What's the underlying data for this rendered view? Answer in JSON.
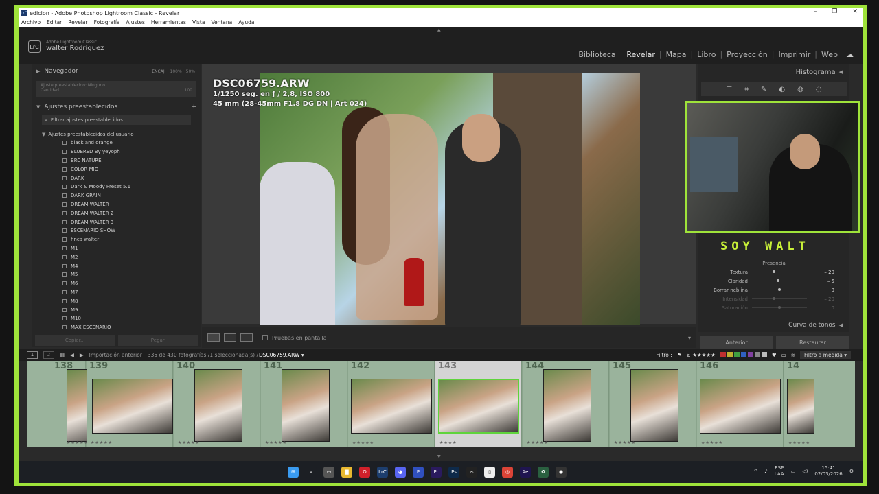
{
  "window": {
    "title": "edicion - Adobe Photoshop Lightroom Classic - Revelar",
    "app_badge": "LrC",
    "controls": [
      "–",
      "❐",
      "✕"
    ]
  },
  "menu": [
    "Archivo",
    "Editar",
    "Revelar",
    "Fotografía",
    "Ajustes",
    "Herramientas",
    "Vista",
    "Ventana",
    "Ayuda"
  ],
  "identity": {
    "logo": "LrC",
    "product": "Adobe Lightroom Classic",
    "user": "walter Rodriguez"
  },
  "modules": [
    "Biblioteca",
    "Revelar",
    "Mapa",
    "Libro",
    "Proyección",
    "Imprimir",
    "Web"
  ],
  "active_module": "Revelar",
  "left_panel": {
    "navigator": "Navegador",
    "nav_fit": "ENCAJ.",
    "nav_100": "100%",
    "nav_50": "50%",
    "preview_label": "Ajuste preestablecido: Ninguno",
    "amount_label": "Cantidad",
    "amount_value": "100",
    "presets_title": "Ajustes preestablecidos",
    "presets_add": "+",
    "filter_placeholder": "Filtrar ajustes preestablecidos",
    "user_group": "Ajustes preestablecidos del usuario",
    "presets": [
      "black and orange",
      "BLUERED By yeyoph",
      "BRC NATURE",
      "COLOR MIO",
      "DARK",
      "Dark & Moody Preset 5.1",
      "DARK GRAIN",
      "DREAM WALTER",
      "DREAM WALTER 2",
      "DREAM WALTER 3",
      "ESCENARIO SHOW",
      "finca walter",
      "M1",
      "M2",
      "M4",
      "M5",
      "M6",
      "M7",
      "M8",
      "M9",
      "M10",
      "MAX ESCENARIO"
    ],
    "copy_button": "Copiar...",
    "paste_button": "Pegar"
  },
  "photo": {
    "filename": "DSC06759.ARW",
    "exposure": "1/1250 seg. en ƒ / 2,8, ISO 800",
    "lens": "45 mm (28-45mm F1.8 DG DN | Art 024)"
  },
  "center_toolbar": {
    "softproof": "Pruebas en pantalla"
  },
  "right_panel": {
    "histogram": "Histograma",
    "presence": "Presencia",
    "sliders": [
      {
        "label": "Textura",
        "value": "– 20",
        "pos": 0.4
      },
      {
        "label": "Claridad",
        "value": "– 5",
        "pos": 0.47
      },
      {
        "label": "Borrar neblina",
        "value": "0",
        "pos": 0.5
      },
      {
        "label": "Intensidad",
        "value": "– 20",
        "pos": 0.4
      },
      {
        "label": "Saturación",
        "value": "0",
        "pos": 0.5
      }
    ],
    "tone_curve": "Curva de tonos",
    "prev_button": "Anterior",
    "reset_button": "Restaurar"
  },
  "overlay": {
    "caption": "SOY WALT"
  },
  "filmstrip_bar": {
    "screen1": "1",
    "screen2": "2",
    "source": "Importación anterior",
    "count": "335 de 430 fotografías /1 seleccionada(s) /",
    "current": "DSC06759.ARW ▾",
    "filter_label": "Filtro :",
    "rating": "≥ ★★★★★",
    "colors": [
      "#c03030",
      "#c0b030",
      "#40a040",
      "#3060c0",
      "#8040a0",
      "#888888",
      "#bbbbbb"
    ],
    "custom_filter": "Filtro a medida ▾"
  },
  "filmstrip": [
    {
      "num": "138",
      "stars": "★★★★★"
    },
    {
      "num": "139",
      "stars": "★★★★★"
    },
    {
      "num": "140",
      "stars": "★★★★★"
    },
    {
      "num": "141",
      "stars": "★★★★★"
    },
    {
      "num": "142",
      "stars": "★★★★★"
    },
    {
      "num": "143",
      "stars": "★★★★",
      "selected": true
    },
    {
      "num": "144",
      "stars": "★★★★★"
    },
    {
      "num": "145",
      "stars": "★★★★★"
    },
    {
      "num": "146",
      "stars": "★★★★★"
    },
    {
      "num": "14",
      "stars": "★★★★★"
    }
  ],
  "taskbar": {
    "apps": [
      {
        "name": "windows-start-icon",
        "glyph": "⊞",
        "color": "#3a9bf0"
      },
      {
        "name": "search-icon",
        "glyph": "⌕",
        "color": "#1c1f24"
      },
      {
        "name": "task-view-icon",
        "glyph": "▭",
        "color": "#555"
      },
      {
        "name": "file-explorer-icon",
        "glyph": "▇",
        "color": "#e8b830"
      },
      {
        "name": "opera-icon",
        "glyph": "O",
        "color": "#d0202a"
      },
      {
        "name": "lightroom-icon",
        "glyph": "LrC",
        "color": "#1d3e6e"
      },
      {
        "name": "discord-icon",
        "glyph": "◕",
        "color": "#5865f2"
      },
      {
        "name": "notes-icon",
        "glyph": "P",
        "color": "#3050c0"
      },
      {
        "name": "premiere-icon",
        "glyph": "Pr",
        "color": "#2a1a5e"
      },
      {
        "name": "photoshop-icon",
        "glyph": "Ps",
        "color": "#0e2a4a"
      },
      {
        "name": "capcut-icon",
        "glyph": "✂",
        "color": "#222"
      },
      {
        "name": "document-icon",
        "glyph": "▯",
        "color": "#eee"
      },
      {
        "name": "chrome-icon",
        "glyph": "◎",
        "color": "#db4437"
      },
      {
        "name": "after-effects-icon",
        "glyph": "Ae",
        "color": "#1f1550"
      },
      {
        "name": "app-icon",
        "glyph": "♻",
        "color": "#2a6040"
      },
      {
        "name": "obs-icon",
        "glyph": "◉",
        "color": "#333"
      }
    ],
    "lang": "ESP",
    "layout": "LAA",
    "time": "15:41",
    "date": "02/03/2026"
  }
}
